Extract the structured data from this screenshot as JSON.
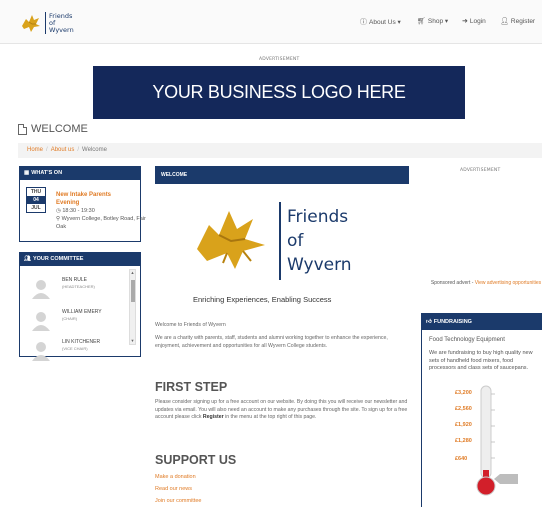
{
  "brand": {
    "line1": "Friends",
    "line2": "of",
    "line3": "Wyvern"
  },
  "nav": [
    {
      "icon": "info-icon",
      "label": "About Us ▾"
    },
    {
      "icon": "cart-icon",
      "label": "Shop ▾"
    },
    {
      "icon": "login-icon",
      "label": "Login"
    },
    {
      "icon": "user-icon",
      "label": "Register"
    }
  ],
  "ads": {
    "top": "ADVERTISEMENT",
    "right": "ADVERTISEMENT",
    "banner": "YOUR BUSINESS LOGO HERE"
  },
  "page_title": "WELCOME",
  "breadcrumb": [
    "Home",
    "About us",
    "Welcome"
  ],
  "whats_on": {
    "header": "WHAT'S ON",
    "event": {
      "day": "THU",
      "date": "04",
      "month": "JUL",
      "title": "New Intake Parents Evening",
      "time": "18:30 - 19:30",
      "location": "Wyvern College, Botley Road, Fair Oak"
    }
  },
  "committee": {
    "header": "YOUR COMMITTEE",
    "members": [
      {
        "name": "BEN RULE",
        "role": "(HEADTEACHER)"
      },
      {
        "name": "WILLIAM EMERY",
        "role": "(CHAIR)"
      },
      {
        "name": "LIN KITCHENER",
        "role": "(VICE CHAIR)"
      }
    ]
  },
  "main": {
    "header": "WELCOME",
    "logo_words": [
      "Friends",
      "of",
      "Wyvern"
    ],
    "tagline": "Enriching Experiences, Enabling Success",
    "intro": "Welcome to Friends of Wyvern",
    "intro2": "We are a charity with parents, staff, students and alumni working together to enhance the experience, enjoyment, achievement and opportunities for all Wyvern College students.",
    "first_step_title": "FIRST STEP",
    "first_step_text_a": "Please consider signing up for a free account on our website. By doing this you will receive our newsletter and updates via email. You will also need an account to make any purchases through the site. To sign up for a free account please click ",
    "first_step_bold": "Register",
    "first_step_text_b": " in the menu at the top right of this page.",
    "support_title": "SUPPORT US",
    "support_links": [
      "Make a donation",
      "Read our news",
      "Join our committee"
    ]
  },
  "sponsored": {
    "text": "Sponsored advert - ",
    "link": "View advertising opportunities"
  },
  "fundraising": {
    "header": "FUNDRAISING",
    "title": "Food Technology Equipment",
    "text": "We are fundraising to buy high quality new sets of handheld food mixers, food processors and class sets of saucepans.",
    "amounts": [
      "£3,200",
      "£2,560",
      "£1,920",
      "£1,280",
      "£640"
    ],
    "progress_fraction": 0.1
  },
  "colors": {
    "navy": "#1b3a6b",
    "orange": "#e07b25",
    "banner": "#14285a"
  }
}
